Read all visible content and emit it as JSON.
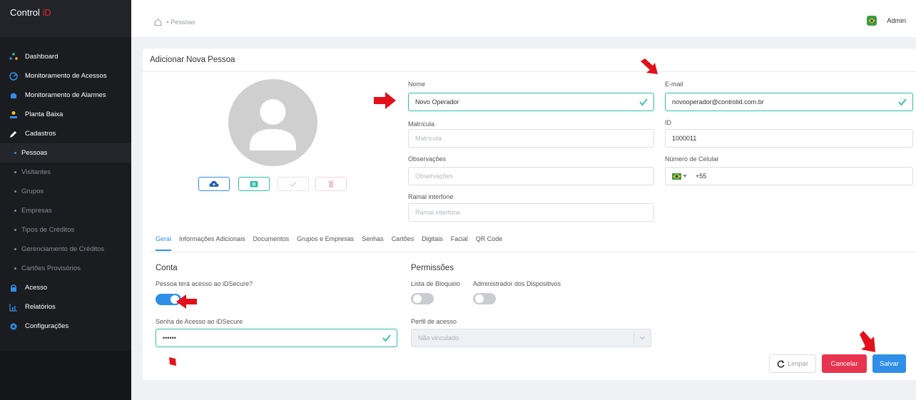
{
  "brand": {
    "prefix": "Control ",
    "accent": "iD"
  },
  "sidebar": {
    "items": [
      {
        "label": "Dashboard",
        "icon": "dashboard-icon"
      },
      {
        "label": "Monitoramento de Acessos",
        "icon": "monitor-access-icon"
      },
      {
        "label": "Monitoramento de Alarmes",
        "icon": "alarm-icon"
      },
      {
        "label": "Planta Baixa",
        "icon": "floorplan-icon"
      },
      {
        "label": "Cadastros",
        "icon": "pencil-icon"
      }
    ],
    "subitems": [
      "Pessoas",
      "Visitantes",
      "Grupos",
      "Empresas",
      "Tipos de Créditos",
      "Gerenciamento de Créditos",
      "Cartões Provisórios"
    ],
    "bottom_items": [
      {
        "label": "Acesso",
        "icon": "lock-icon"
      },
      {
        "label": "Relatórios",
        "icon": "chart-icon"
      },
      {
        "label": "Configurações",
        "icon": "gear-icon"
      }
    ]
  },
  "topbar": {
    "breadcrumb": "Pessoas",
    "user": "Admin"
  },
  "card": {
    "title": "Adicionar Nova Pessoa",
    "fields": {
      "nome": {
        "label": "Nome",
        "value": "Novo Operador"
      },
      "email": {
        "label": "E-mail",
        "value": "novooperador@controlid.com.br"
      },
      "matricula": {
        "label": "Matrícula",
        "placeholder": "Matrícula"
      },
      "id": {
        "label": "ID",
        "value": "1000011"
      },
      "observacoes": {
        "label": "Observações",
        "placeholder": "Observações"
      },
      "celular": {
        "label": "Número de Celular",
        "value": "+55"
      },
      "ramal": {
        "label": "Ramal interfone",
        "placeholder": "Ramal interfone"
      }
    },
    "tabs": [
      "Geral",
      "Informações Adicionais",
      "Documentos",
      "Grupos e Empresas",
      "Senhas",
      "Cartões",
      "Digitais",
      "Facial",
      "QR Code"
    ],
    "conta": {
      "title": "Conta",
      "access_label": "Pessoa terá acesso ao iDSecure?",
      "password_label": "Senha de Acesso ao iDSecure",
      "password_value": "••••••"
    },
    "permissoes": {
      "title": "Permissões",
      "block_label": "Lista de Bloqueio",
      "admin_label": "Administrador dos Dispositivos",
      "profile_label": "Perfil de acesso",
      "profile_value": "Não vinculado"
    },
    "buttons": {
      "clear": "Limpar",
      "cancel": "Cancelar",
      "save": "Salvar"
    }
  },
  "colors": {
    "primary": "#2f8fe8",
    "success": "#2fbfa8",
    "danger": "#e8344e",
    "sidebar": "#1b1c20",
    "annotation": "#e3101b"
  }
}
